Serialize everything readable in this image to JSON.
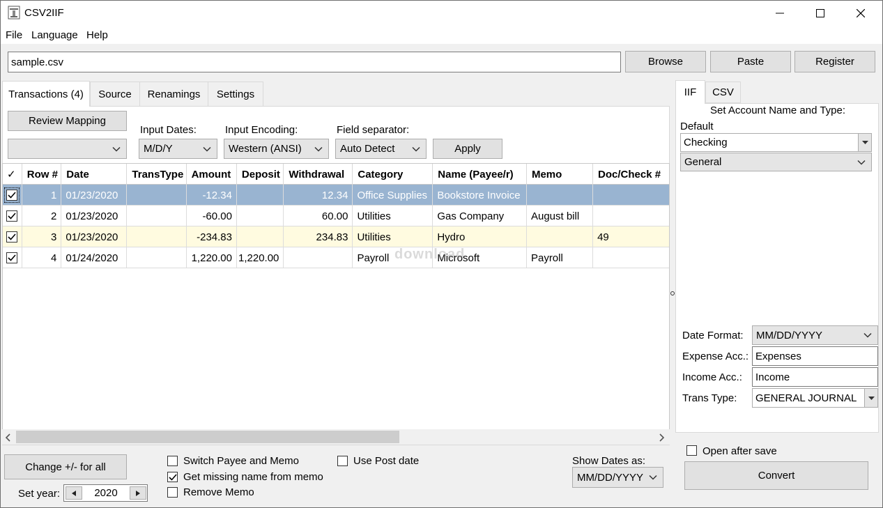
{
  "window": {
    "title": "CSV2IIF",
    "minimize_glyph": "—",
    "maximize_glyph": "☐",
    "close_glyph": "✕"
  },
  "menu": {
    "file": "File",
    "language": "Language",
    "help": "Help"
  },
  "file_bar": {
    "path_value": "sample.csv",
    "browse": "Browse",
    "paste": "Paste",
    "register": "Register"
  },
  "tabs": {
    "transactions": "Transactions (4)",
    "source": "Source",
    "renamings": "Renamings",
    "settings": "Settings"
  },
  "controls": {
    "review_mapping": "Review Mapping",
    "mapping_value": "",
    "input_dates_label": "Input Dates:",
    "input_dates_value": "M/D/Y",
    "input_encoding_label": "Input Encoding:",
    "input_encoding_value": "Western (ANSI)",
    "field_separator_label": "Field separator:",
    "field_separator_value": "Auto Detect",
    "apply": "Apply"
  },
  "grid": {
    "headers": {
      "check": "✓",
      "row": "Row #",
      "date": "Date",
      "transtype": "TransType",
      "amount": "Amount",
      "deposit": "Deposit",
      "withdrawal": "Withdrawal",
      "category": "Category",
      "name": "Name (Payee/r)",
      "memo": "Memo",
      "doc": "Doc/Check #"
    },
    "rows": [
      {
        "row": "1",
        "date": "01/23/2020",
        "transtype": "",
        "amount": "-12.34",
        "deposit": "",
        "withdrawal": "12.34",
        "category": "Office Supplies",
        "name": "Bookstore Invoice",
        "memo": "",
        "doc": ""
      },
      {
        "row": "2",
        "date": "01/23/2020",
        "transtype": "",
        "amount": "-60.00",
        "deposit": "",
        "withdrawal": "60.00",
        "category": "Utilities",
        "name": "Gas Company",
        "memo": "August bill",
        "doc": ""
      },
      {
        "row": "3",
        "date": "01/23/2020",
        "transtype": "",
        "amount": "-234.83",
        "deposit": "",
        "withdrawal": "234.83",
        "category": "Utilities",
        "name": "Hydro",
        "memo": "",
        "doc": "49"
      },
      {
        "row": "4",
        "date": "01/24/2020",
        "transtype": "",
        "amount": "1,220.00",
        "deposit": "1,220.00",
        "withdrawal": "",
        "category": "Payroll",
        "name": "Microsoft",
        "memo": "Payroll",
        "doc": ""
      }
    ]
  },
  "bottom": {
    "change_sign": "Change +/- for all",
    "set_year_label": "Set year:",
    "year_value": "2020",
    "switch_payee_memo": "Switch Payee and Memo",
    "get_missing_name": "Get missing name from memo",
    "remove_memo": "Remove Memo",
    "use_post_date": "Use Post date",
    "show_dates_label": "Show Dates as:",
    "show_dates_value": "MM/DD/YYYY"
  },
  "right": {
    "tab_iif": "IIF",
    "tab_csv": "CSV",
    "set_account_label": "Set Account Name and Type:",
    "default_label": "Default",
    "account_name": "Checking",
    "account_type": "General",
    "date_format_label": "Date Format:",
    "date_format_value": "MM/DD/YYYY",
    "expense_label": "Expense Acc.:",
    "expense_value": "Expenses",
    "income_label": "Income Acc.:",
    "income_value": "Income",
    "trans_type_label": "Trans Type:",
    "trans_type_value": "GENERAL JOURNAL",
    "open_after_save": "Open after save",
    "convert": "Convert"
  },
  "watermark": "download"
}
